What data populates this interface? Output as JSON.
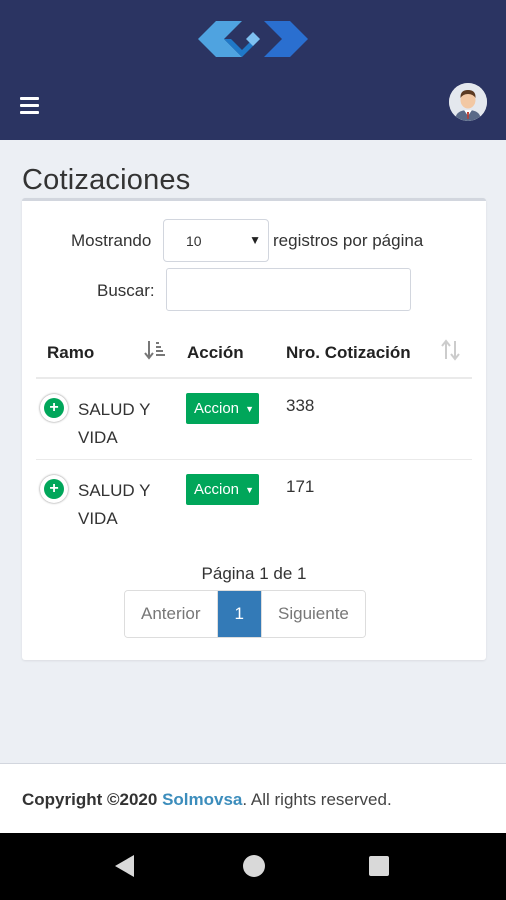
{
  "header": {
    "menu_icon": "hamburger-icon",
    "logo_icon": "chevron-logo-icon",
    "avatar": "user-avatar"
  },
  "page": {
    "title": "Cotizaciones"
  },
  "table_controls": {
    "length_label": "Mostrando",
    "length_value": "10",
    "length_suffix": "registros por página",
    "search_label": "Buscar:",
    "search_value": ""
  },
  "table": {
    "columns": [
      "Ramo",
      "Acción",
      "Nro. Cotización"
    ],
    "rows": [
      {
        "ramo": "SALUD Y VIDA",
        "accion": "Accion",
        "nro": "338"
      },
      {
        "ramo": "SALUD Y VIDA",
        "accion": "Accion",
        "nro": "171"
      }
    ]
  },
  "pagination": {
    "info": "Página 1 de 1",
    "prev": "Anterior",
    "current": "1",
    "next": "Siguiente"
  },
  "footer": {
    "prefix": "Copyright ©2020",
    "brand": "Solmovsa",
    "suffix": ". All rights reserved."
  },
  "colors": {
    "header_bg": "#2b3462",
    "accent_green": "#00a65a",
    "accent_blue": "#337ab7",
    "link": "#3c8dbc"
  }
}
